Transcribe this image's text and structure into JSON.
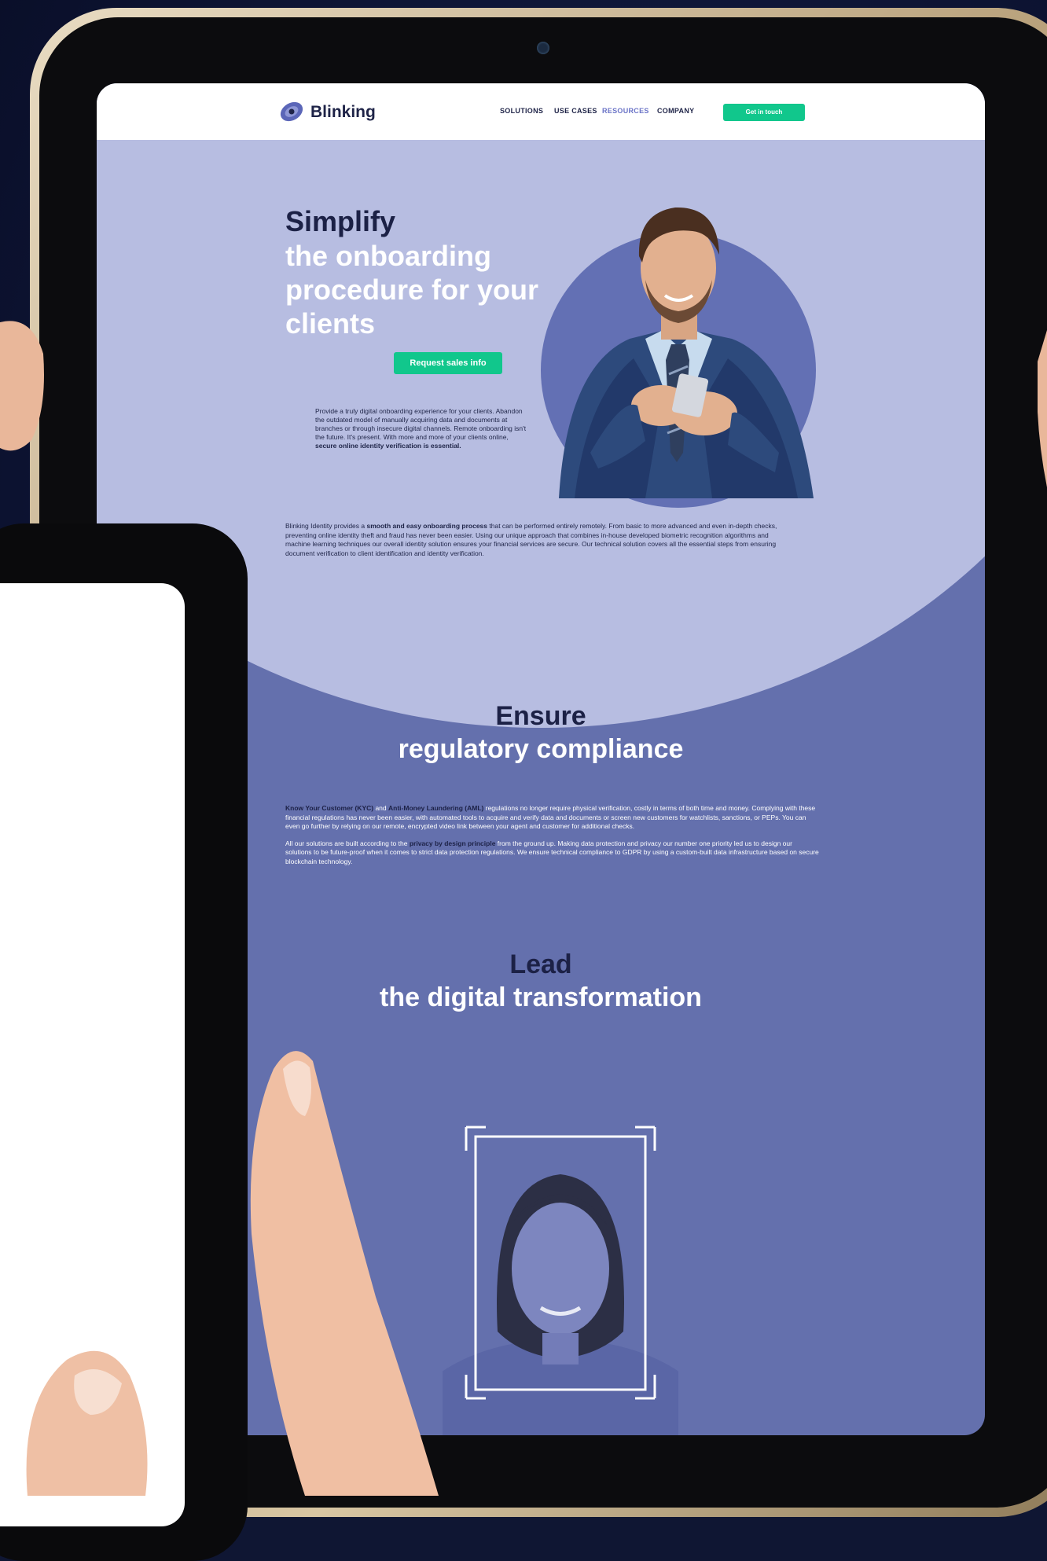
{
  "nav": {
    "logo": "Blinking",
    "links": [
      "SOLUTIONS",
      "USE CASES",
      "RESOURCES",
      "COMPANY"
    ],
    "active_link": "RESOURCES",
    "cta": "Get in touch"
  },
  "hero": {
    "title_dark": "Simplify",
    "title_light": "the onboarding procedure for your clients",
    "cta": "Request sales info",
    "intro_text": "Provide a truly digital onboarding experience for your clients. Abandon the outdated model of manually acquiring data and documents at branches or through insecure digital channels. Remote onboarding isn't the future. It's present. With more and more of your clients online,",
    "intro_bold": "secure online identity verification is essential.",
    "para_start": "Blinking Identity provides a",
    "para_bold": "smooth and easy onboarding process",
    "para_rest": "that can be performed entirely remotely. From basic to more advanced and even in-depth checks, preventing online identity theft and fraud has never been easier. Using our unique approach that combines in-house developed biometric recognition algorithms and machine learning techniques our overall identity solution ensures your financial services are secure. Our technical solution covers all the essential steps from ensuring document verification to client identification and identity verification."
  },
  "compliance": {
    "title_dark": "Ensure",
    "title_light": "regulatory compliance",
    "kyc_bold": "Know Your Customer (KYC)",
    "kyc_and": "and",
    "aml_bold": "Anti-Money Laundering (AML)",
    "kyc_rest": "regulations no longer require physical verification, costly in terms of both time and money. Complying with these financial regulations has never been easier, with automated tools to acquire and verify data and documents or screen new customers for watchlists, sanctions, or PEPs. You can even go further by relying on our remote, encrypted video link between your agent and customer for additional checks.",
    "privacy_start": "All our solutions are built according to the",
    "privacy_bold": "privacy by design principle",
    "privacy_rest": "from the ground up. Making data protection and privacy our number one priority led us to design our solutions to be future-proof when it comes to strict data protection regulations. We ensure technical compliance to GDPR by using a custom-built data infrastructure based on secure blockchain technology."
  },
  "transformation": {
    "title_dark": "Lead",
    "title_light": "the digital transformation"
  },
  "colors": {
    "screen_bg": "#6470ad",
    "hero_bg": "#b7bde1",
    "accent_green": "#11c78c",
    "dark_text": "#1c2146"
  }
}
